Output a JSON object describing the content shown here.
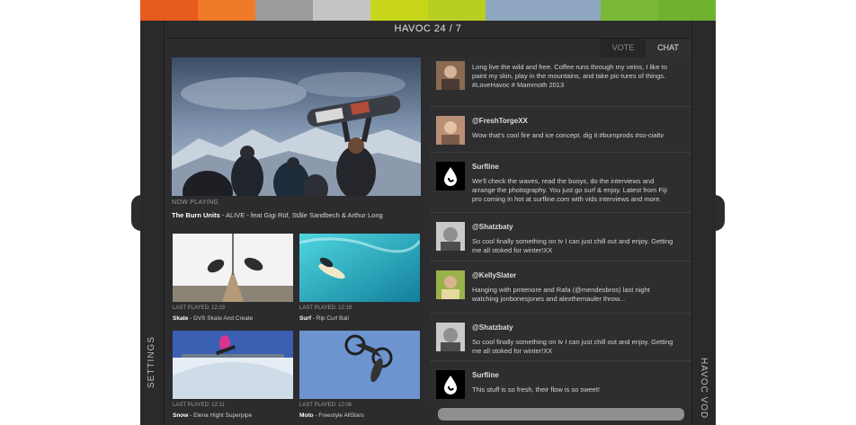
{
  "colors": {
    "bar": [
      "#e65a1f",
      "#f07a2a",
      "#9c9c9c",
      "#c5c5c5",
      "#c7d61b",
      "#b7cf22",
      "#8fa7c0",
      "#8ea6bf",
      "#79b937",
      "#6fb22f"
    ],
    "background": "#2c2c2e"
  },
  "header": {
    "title": "HAVOC 24 / 7"
  },
  "tabs": [
    {
      "label": "VOTE"
    },
    {
      "label": "CHAT"
    }
  ],
  "sidebar": {
    "left_label": "SETTINGS",
    "right_label": "HAVOC VOD"
  },
  "now_playing": {
    "label": "NOW PLAYING",
    "artist": "The Burn Units",
    "rest": " - ALIVE - feat Gigi Rüf, Ståle Sandbech & Arthur Long"
  },
  "thumbs": [
    {
      "meta": "LAST PLAYED: 12:23",
      "category": "Skate",
      "title": " - DVS Skate And Create"
    },
    {
      "meta": "LAST PLAYED: 12:19",
      "category": "Surf",
      "title": " - Rip Curl Bali"
    },
    {
      "meta": "LAST PLAYED: 12:11",
      "category": "Snow",
      "title": " - Elena Hight Superpipe"
    },
    {
      "meta": "LAST PLAYED: 12:06",
      "category": "Moto",
      "title": " - Freestyle AllStars"
    }
  ],
  "tweets": [
    {
      "handle": "",
      "text": "Long live the wild and free. Coffee runs through my veins, I like to paint my skin, play in the mountains, and take pic-tures of things. #LoveHavoc # Mammoth 2013"
    },
    {
      "handle": "@FreshTorgeXX",
      "text": "Wow that's cool fire and ice concept. dig it #burnprods #so-cialtv"
    },
    {
      "handle": "Surfline",
      "text": "We'll check the waves, read the buoys, do the interviews and arrange the photography. You just go surf & enjoy. Latest from Fiji pro coming in hot at surfline.com with vids interviews and more."
    },
    {
      "handle": "@Shatzbaty",
      "text": "So cool finally something on tv I can just chill out and enjoy. Getting me all stoked for winter!XX"
    },
    {
      "handle": "@KellySlater",
      "text": "Hanging with pmtenore and Rafa (@mendesbros) last night watching jonbonesjones and alexthemauler throw..."
    },
    {
      "handle": "@Shatzbaty",
      "text": "So cool finally something on tv I can just chill out and enjoy. Getting me all stoked for winter!XX"
    },
    {
      "handle": "Surfline",
      "text": "This stuff is so fresh, their flow is so sweet!"
    }
  ]
}
